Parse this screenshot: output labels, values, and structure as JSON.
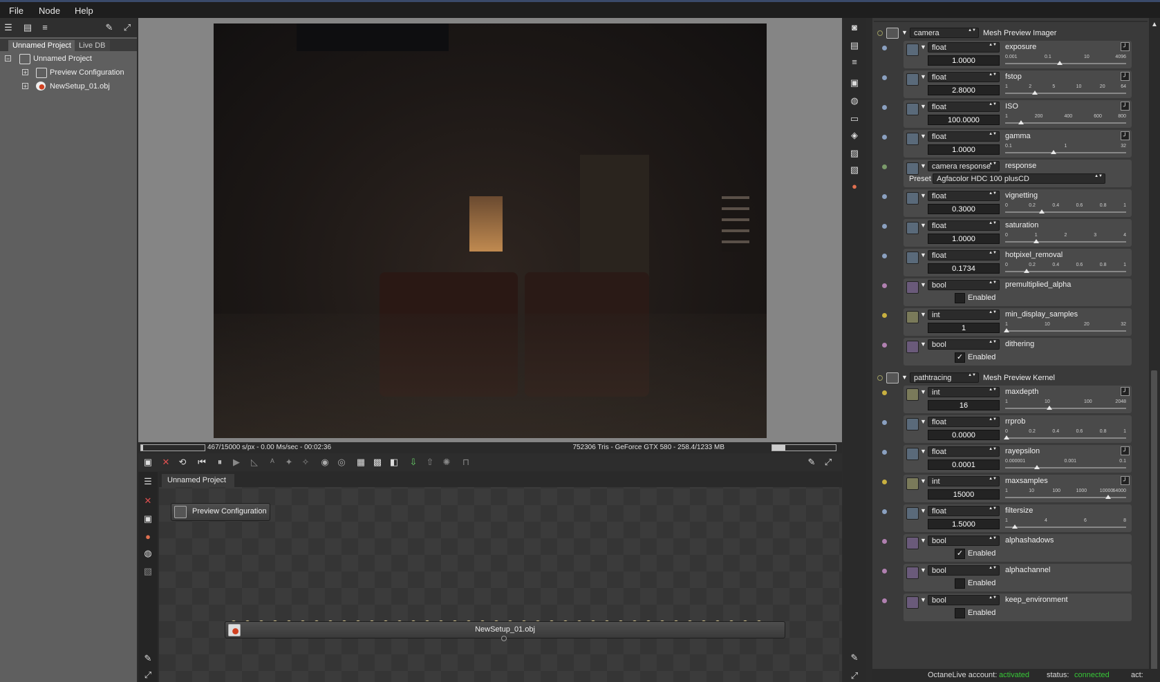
{
  "menu": {
    "items": [
      "File",
      "Node",
      "Help"
    ]
  },
  "left_panel": {
    "tabs": [
      "Unnamed Project",
      "Live DB"
    ],
    "tree": {
      "root": "Unnamed Project",
      "children": [
        "Preview Configuration",
        "NewSetup_01.obj"
      ]
    }
  },
  "viewport": {
    "status_left": "467/15000 s/px - 0.00 Ms/sec - 00:02:36",
    "status_right": "752306 Tris - GeForce GTX 580 - 258.4/1233 MB"
  },
  "graph": {
    "tab": "Unnamed Project",
    "node_preview": "Preview Configuration",
    "node_mesh": "NewSetup_01.obj"
  },
  "inspector": {
    "camera_group": {
      "type": "camera",
      "title": "Mesh Preview Imager"
    },
    "camera_params": [
      {
        "type": "float",
        "name": "exposure",
        "value": "1.0000",
        "ticks": [
          "0.001",
          "0.1",
          "10",
          "4096"
        ],
        "level": 0.45,
        "curve": true,
        "dot": "#8aa0c0"
      },
      {
        "type": "float",
        "name": "fstop",
        "value": "2.8000",
        "ticks": [
          "1",
          "2",
          "5",
          "10",
          "20",
          "64"
        ],
        "level": 0.24,
        "curve": true,
        "dot": "#8aa0c0"
      },
      {
        "type": "float",
        "name": "ISO",
        "value": "100.0000",
        "ticks": [
          "1",
          "200",
          "400",
          "600",
          "800"
        ],
        "level": 0.12,
        "curve": true,
        "dot": "#8aa0c0"
      },
      {
        "type": "float",
        "name": "gamma",
        "value": "1.0000",
        "ticks": [
          "0.1",
          "1",
          "32"
        ],
        "level": 0.4,
        "curve": true,
        "dot": "#8aa0c0"
      }
    ],
    "response": {
      "type": "camera response",
      "name": "response",
      "preset_label": "Preset",
      "preset_value": "Agfacolor HDC 100 plusCD",
      "dot": "#7a9a6a"
    },
    "camera_params2": [
      {
        "type": "float",
        "name": "vignetting",
        "value": "0.3000",
        "ticks": [
          "0",
          "0.2",
          "0.4",
          "0.6",
          "0.8",
          "1"
        ],
        "level": 0.3,
        "curve": false,
        "dot": "#8aa0c0"
      },
      {
        "type": "float",
        "name": "saturation",
        "value": "1.0000",
        "ticks": [
          "0",
          "1",
          "2",
          "3",
          "4"
        ],
        "level": 0.25,
        "curve": false,
        "dot": "#8aa0c0"
      },
      {
        "type": "float",
        "name": "hotpixel_removal",
        "value": "0.1734",
        "ticks": [
          "0",
          "0.2",
          "0.4",
          "0.6",
          "0.8",
          "1"
        ],
        "level": 0.17,
        "curve": false,
        "dot": "#8aa0c0"
      }
    ],
    "camera_bools": [
      {
        "type": "bool",
        "name": "premultiplied_alpha",
        "enabled_label": "Enabled",
        "checked": false,
        "dot": "#b080b0"
      }
    ],
    "min_display": {
      "type": "int",
      "name": "min_display_samples",
      "value": "1",
      "ticks": [
        "1",
        "10",
        "20",
        "32"
      ],
      "level": 0.0,
      "dot": "#c8b040"
    },
    "dithering": {
      "type": "bool",
      "name": "dithering",
      "enabled_label": "Enabled",
      "checked": true,
      "dot": "#b080b0"
    },
    "kernel_group": {
      "type": "pathtracing",
      "title": "Mesh Preview Kernel"
    },
    "kernel_params": [
      {
        "type": "int",
        "name": "maxdepth",
        "value": "16",
        "ticks": [
          "1",
          "10",
          "100",
          "2048"
        ],
        "level": 0.36,
        "curve": true,
        "dot": "#c8b040"
      },
      {
        "type": "float",
        "name": "rrprob",
        "value": "0.0000",
        "ticks": [
          "0",
          "0.2",
          "0.4",
          "0.6",
          "0.8",
          "1"
        ],
        "level": 0.0,
        "curve": false,
        "dot": "#8aa0c0"
      },
      {
        "type": "float",
        "name": "rayepsilon",
        "value": "0.0001",
        "ticks": [
          "0.000001",
          "0.001",
          "0.1"
        ],
        "level": 0.26,
        "curve": true,
        "dot": "#8aa0c0"
      },
      {
        "type": "int",
        "name": "maxsamples",
        "value": "15000",
        "ticks": [
          "1",
          "10",
          "100",
          "1000",
          "10000",
          "64000"
        ],
        "level": 0.86,
        "curve": true,
        "dot": "#c8b040"
      },
      {
        "type": "float",
        "name": "filtersize",
        "value": "1.5000",
        "ticks": [
          "1",
          "4",
          "6",
          "8"
        ],
        "level": 0.07,
        "curve": false,
        "dot": "#8aa0c0"
      }
    ],
    "kernel_bools": [
      {
        "type": "bool",
        "name": "alphashadows",
        "enabled_label": "Enabled",
        "checked": true,
        "dot": "#b080b0"
      },
      {
        "type": "bool",
        "name": "alphachannel",
        "enabled_label": "Enabled",
        "checked": false,
        "dot": "#b080b0"
      },
      {
        "type": "bool",
        "name": "keep_environment",
        "enabled_label": "Enabled",
        "checked": false,
        "dot": "#b080b0"
      }
    ]
  },
  "status": {
    "account_label": "OctaneLive account:",
    "account_value": "activated",
    "status_label": "status:",
    "status_value": "connected",
    "act_label": "act:"
  },
  "colors": {
    "accent_green": "#37c837"
  }
}
